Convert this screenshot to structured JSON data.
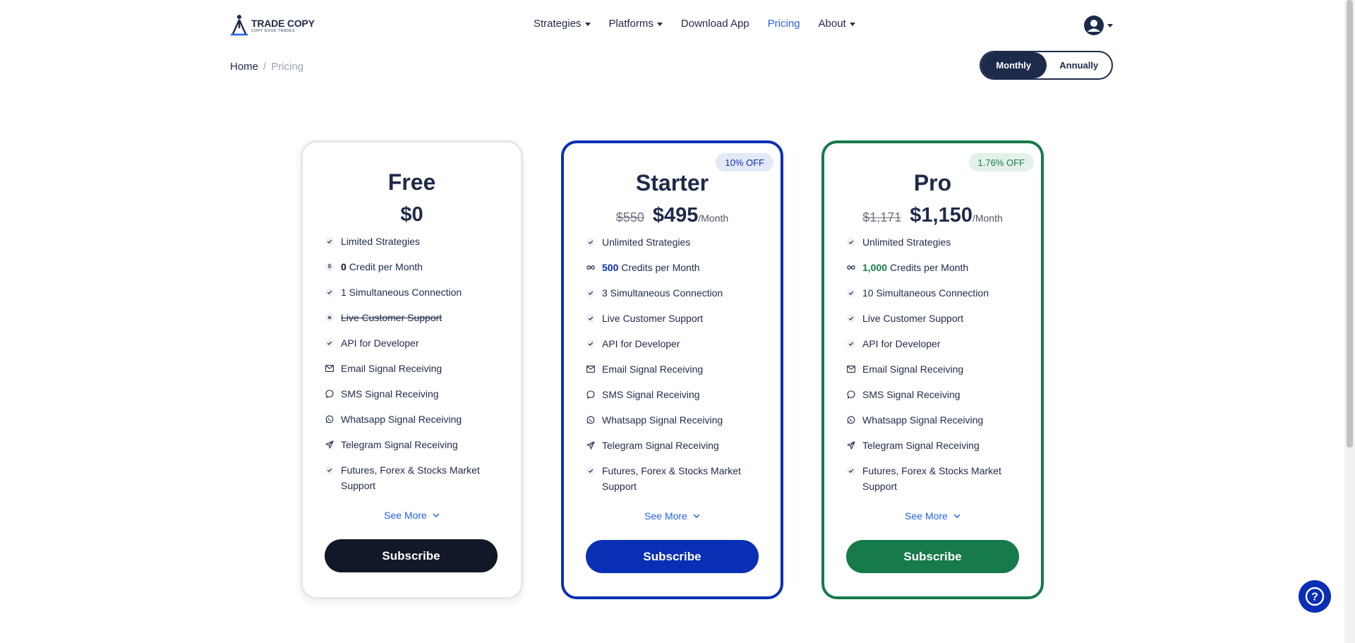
{
  "brand": {
    "name": "TRADE COPY",
    "tagline": "COPY GOOD TRADES"
  },
  "nav": {
    "items": [
      {
        "label": "Strategies",
        "dropdown": true
      },
      {
        "label": "Platforms",
        "dropdown": true
      },
      {
        "label": "Download App",
        "dropdown": false
      },
      {
        "label": "Pricing",
        "dropdown": false,
        "active": true
      },
      {
        "label": "About",
        "dropdown": true
      }
    ]
  },
  "breadcrumb": {
    "home": "Home",
    "separator": "/",
    "current": "Pricing"
  },
  "billing_toggle": {
    "monthly": "Monthly",
    "annually": "Annually",
    "selected": "Monthly"
  },
  "plans": [
    {
      "name": "Free",
      "price": "$0",
      "old_price": "",
      "period": "",
      "badge": "",
      "accent": "#111827",
      "features": [
        {
          "icon": "check-icon",
          "text": "Limited Strategies"
        },
        {
          "icon": "zero-icon",
          "highlight": "0",
          "text": "Credit per Month"
        },
        {
          "icon": "check-icon",
          "text": "1 Simultaneous Connection"
        },
        {
          "icon": "x-icon",
          "text": "Live Customer Support",
          "disabled": true
        },
        {
          "icon": "check-icon",
          "text": "API for Developer"
        },
        {
          "icon": "mail-icon",
          "text": "Email Signal Receiving"
        },
        {
          "icon": "chat-icon",
          "text": "SMS Signal Receiving"
        },
        {
          "icon": "whatsapp-icon",
          "text": "Whatsapp Signal Receiving"
        },
        {
          "icon": "send-icon",
          "text": "Telegram Signal Receiving"
        },
        {
          "icon": "check-icon",
          "text": "Futures, Forex & Stocks Market Support"
        }
      ],
      "see_more": "See More",
      "cta": "Subscribe"
    },
    {
      "name": "Starter",
      "price": "$495",
      "old_price": "$550",
      "period": "/Month",
      "badge": "10% OFF",
      "accent": "#0a2fb5",
      "features": [
        {
          "icon": "check-icon",
          "text": "Unlimited Strategies"
        },
        {
          "icon": "infinity-icon",
          "highlight": "500",
          "text": "Credits per Month"
        },
        {
          "icon": "check-icon",
          "text": "3 Simultaneous Connection"
        },
        {
          "icon": "check-icon",
          "text": "Live Customer Support"
        },
        {
          "icon": "check-icon",
          "text": "API for Developer"
        },
        {
          "icon": "mail-icon",
          "text": "Email Signal Receiving"
        },
        {
          "icon": "chat-icon",
          "text": "SMS Signal Receiving"
        },
        {
          "icon": "whatsapp-icon",
          "text": "Whatsapp Signal Receiving"
        },
        {
          "icon": "send-icon",
          "text": "Telegram Signal Receiving"
        },
        {
          "icon": "check-icon",
          "text": "Futures, Forex & Stocks Market Support"
        }
      ],
      "see_more": "See More",
      "cta": "Subscribe"
    },
    {
      "name": "Pro",
      "price": "$1,150",
      "old_price": "$1,171",
      "period": "/Month",
      "badge": "1.76% OFF",
      "accent": "#167a4a",
      "features": [
        {
          "icon": "check-icon",
          "text": "Unlimited Strategies"
        },
        {
          "icon": "infinity-icon",
          "highlight": "1,000",
          "text": "Credits per Month"
        },
        {
          "icon": "check-icon",
          "text": "10 Simultaneous Connection"
        },
        {
          "icon": "check-icon",
          "text": "Live Customer Support"
        },
        {
          "icon": "check-icon",
          "text": "API for Developer"
        },
        {
          "icon": "mail-icon",
          "text": "Email Signal Receiving"
        },
        {
          "icon": "chat-icon",
          "text": "SMS Signal Receiving"
        },
        {
          "icon": "whatsapp-icon",
          "text": "Whatsapp Signal Receiving"
        },
        {
          "icon": "send-icon",
          "text": "Telegram Signal Receiving"
        },
        {
          "icon": "check-icon",
          "text": "Futures, Forex & Stocks Market Support"
        }
      ],
      "see_more": "See More",
      "cta": "Subscribe"
    }
  ],
  "help": {
    "icon": "help-icon",
    "glyph": "?"
  },
  "colors": {
    "navy": "#1e2a4a",
    "blue": "#0a2fb5",
    "green": "#167a4a",
    "link": "#2563eb"
  }
}
